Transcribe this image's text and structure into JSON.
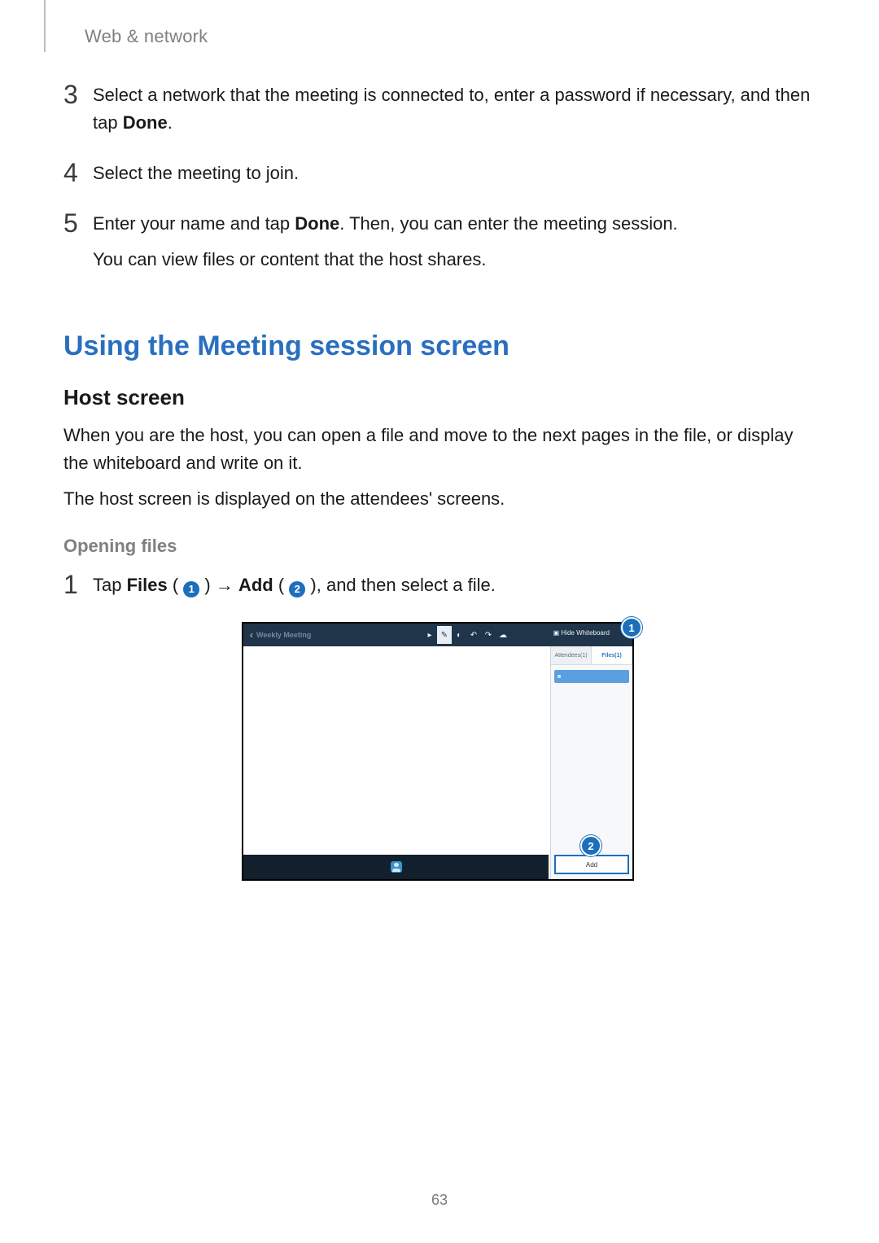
{
  "breadcrumb": "Web & network",
  "steps_top": [
    {
      "num": "3",
      "line1_pre": "Select a network that the meeting is connected to, enter a password if necessary, and then tap ",
      "line1_strong": "Done",
      "line1_post": "."
    },
    {
      "num": "4",
      "line1_pre": "Select the meeting to join.",
      "line1_strong": "",
      "line1_post": ""
    },
    {
      "num": "5",
      "line1_pre": "Enter your name and tap ",
      "line1_strong": "Done",
      "line1_post": ". Then, you can enter the meeting session.",
      "line2": "You can view files or content that the host shares."
    }
  ],
  "h2": "Using the Meeting session screen",
  "h3": "Host screen",
  "host_para1": "When you are the host, you can open a file and move to the next pages in the file, or display the whiteboard and write on it.",
  "host_para2": "The host screen is displayed on the attendees' screens.",
  "h4": "Opening files",
  "opening_step": {
    "num": "1",
    "pre": "Tap ",
    "b1": "Files",
    "p1": " ( ",
    "c1": "1",
    "p2": " ) → ",
    "b2": "Add",
    "p3": " ( ",
    "c2": "2",
    "p4": " ), and then select a file."
  },
  "screenshot": {
    "meeting_title": "Weekly Meeting",
    "hide_whiteboard": "Hide Whiteboard",
    "attendee_tab": "Attendees(1)",
    "files_tab": "Files(1)",
    "add_button": "Add",
    "callout1": "1",
    "callout2": "2"
  },
  "page_number": "63"
}
